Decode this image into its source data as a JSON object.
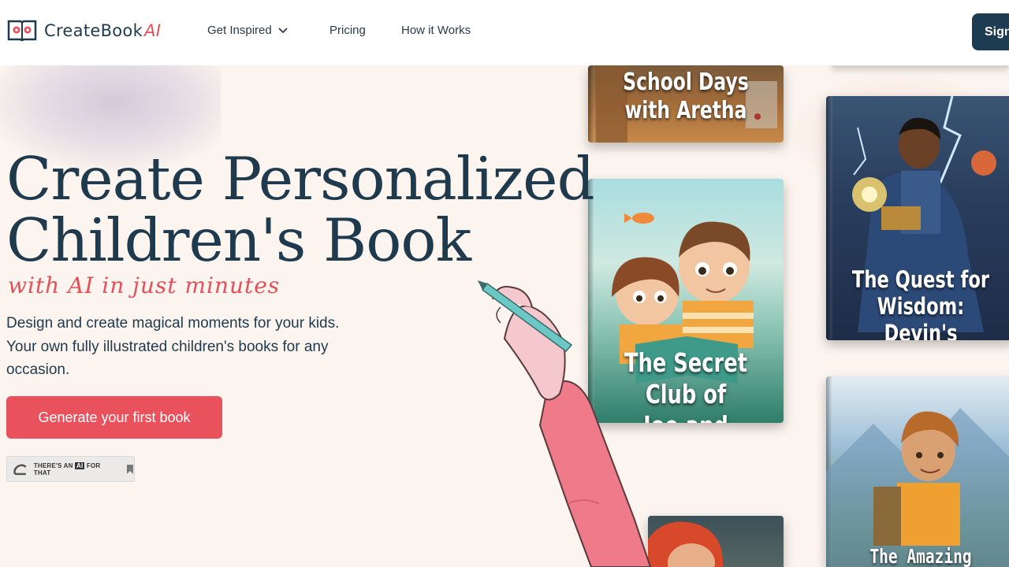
{
  "brand": {
    "name": "CreateBook",
    "suffix": "AI"
  },
  "nav": {
    "items": [
      {
        "label": "Get Inspired"
      },
      {
        "label": "Pricing"
      },
      {
        "label": "How it Works"
      }
    ],
    "signin_label": "Sign"
  },
  "hero": {
    "title_line1": "Create Personalized",
    "title_line2": "Children's Book",
    "tagline": "with AI in just minutes",
    "description": "Design and create magical moments for your kids. Your own fully illustrated children's books for any occasion.",
    "cta_label": "Generate your first book",
    "badge_text": "THERE'S AN",
    "badge_ai": "AI",
    "badge_text2": "FOR THAT"
  },
  "books": [
    {
      "line1": "School Days",
      "line2": "with Aretha"
    },
    {
      "line1": "The Secret Club of",
      "line2": "Joe and Margaret"
    },
    {
      "line1": "The Quest for Wisdom:",
      "line2": "Devin's Journey"
    },
    {
      "line1": "The Amazing",
      "line2": ""
    }
  ],
  "colors": {
    "primary": "#1f3a4d",
    "accent": "#e9515c",
    "background": "#fcf4ee"
  }
}
